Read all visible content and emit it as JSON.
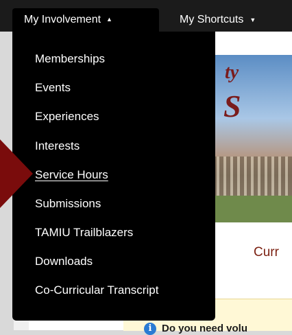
{
  "nav": {
    "involvement_label": "My Involvement",
    "shortcuts_label": "My Shortcuts"
  },
  "menu": {
    "items": [
      {
        "label": "Memberships"
      },
      {
        "label": "Events"
      },
      {
        "label": "Experiences"
      },
      {
        "label": "Interests"
      },
      {
        "label": "Service Hours"
      },
      {
        "label": "Submissions"
      },
      {
        "label": "TAMIU Trailblazers"
      },
      {
        "label": "Downloads"
      },
      {
        "label": "Co-Curricular Transcript"
      }
    ],
    "highlighted": "Service Hours"
  },
  "background": {
    "banner_text_1": "ty",
    "banner_text_2": "S",
    "subtitle": "Curr",
    "notice": "Do you need volu"
  },
  "colors": {
    "navbar": "#1b1b1b",
    "menu_bg": "#000000",
    "pointer": "#7a0c0c",
    "subtitle": "#7a1f10"
  },
  "icons": {
    "caret_up": "▲",
    "caret_down": "▼",
    "info": "i"
  }
}
